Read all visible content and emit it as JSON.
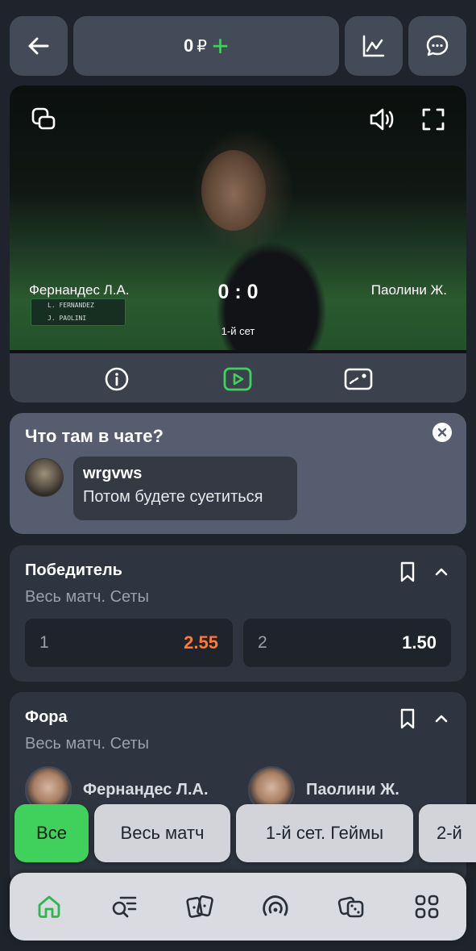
{
  "topbar": {
    "balance": "0",
    "currency": "₽",
    "add_symbol": "+"
  },
  "video": {
    "player_left": "Фернандес Л.А.",
    "player_right": "Паолини Ж.",
    "score": "0 : 0",
    "set_label": "1-й сет",
    "board_row1": "L. FERNANDEZ",
    "board_row2": "J. PAOLINI"
  },
  "chat": {
    "title": "Что там в чате?",
    "username": "wrgvws",
    "message": "Потом будете суетиться"
  },
  "winner_market": {
    "title": "Победитель",
    "subtitle": "Весь матч. Сеты",
    "odds": [
      {
        "label": "1",
        "value": "2.55",
        "color": "#ff7a2f"
      },
      {
        "label": "2",
        "value": "1.50",
        "color": "#ffffff"
      }
    ]
  },
  "handicap_market": {
    "title": "Фора",
    "subtitle": "Весь матч. Сеты",
    "teams": [
      "Фернандес Л.А.",
      "Паолини Ж."
    ]
  },
  "chips": [
    "Все",
    "Весь матч",
    "1-й сет. Геймы",
    "2-й"
  ],
  "colors": {
    "accent": "#3fd15b",
    "odd_up": "#ff7a2f",
    "background": "#1f232b",
    "card": "#2f3540"
  },
  "nav": [
    "home-icon",
    "search-list-icon",
    "cards-icon",
    "live-icon",
    "dice-icon",
    "grid-icon"
  ]
}
